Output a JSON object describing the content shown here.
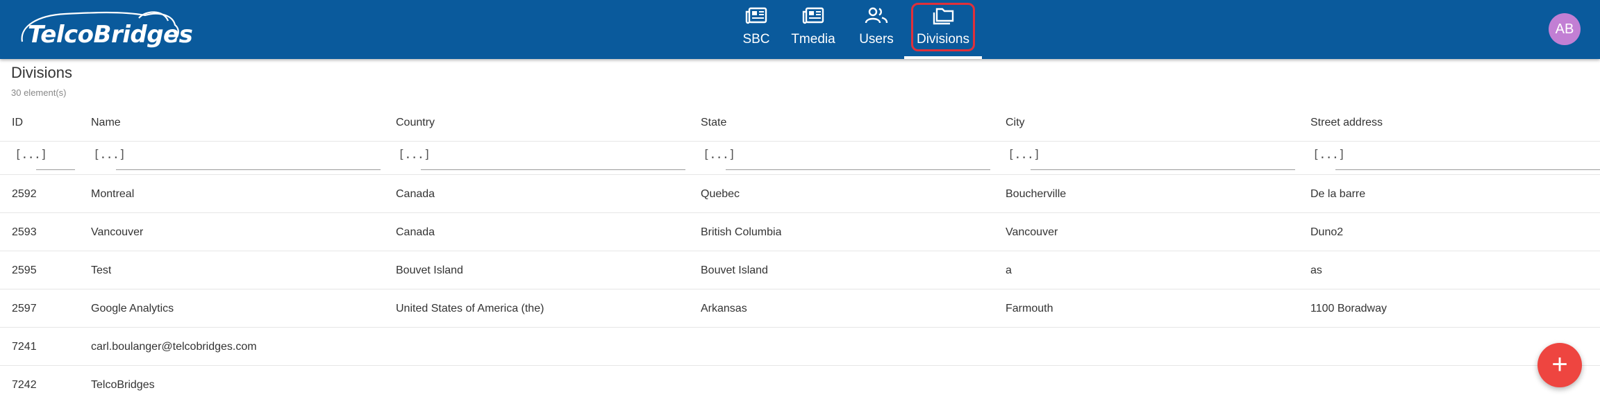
{
  "brand": {
    "logo_text": "TelcoBridges"
  },
  "nav": [
    {
      "label": "SBC",
      "icon": "newspaper-icon"
    },
    {
      "label": "Tmedia",
      "icon": "newspaper-icon"
    },
    {
      "label": "Users",
      "icon": "users-icon"
    },
    {
      "label": "Divisions",
      "icon": "folders-icon",
      "active": true
    }
  ],
  "user": {
    "initials": "AB"
  },
  "page": {
    "title": "Divisions",
    "count": "30 element(s)"
  },
  "table": {
    "columns": [
      "ID",
      "Name",
      "Country",
      "State",
      "City",
      "Street address"
    ],
    "filter_button": "[...]",
    "rows": [
      {
        "id": "2592",
        "name": "Montreal",
        "country": "Canada",
        "state": "Quebec",
        "city": "Boucherville",
        "street": "De la barre"
      },
      {
        "id": "2593",
        "name": "Vancouver",
        "country": "Canada",
        "state": "British Columbia",
        "city": "Vancouver",
        "street": "Duno2"
      },
      {
        "id": "2595",
        "name": "Test",
        "country": "Bouvet Island",
        "state": "Bouvet Island",
        "city": "a",
        "street": "as"
      },
      {
        "id": "2597",
        "name": "Google Analytics",
        "country": "United States of America (the)",
        "state": "Arkansas",
        "city": "Farmouth",
        "street": "1100 Boradway"
      },
      {
        "id": "7241",
        "name": "carl.boulanger@telcobridges.com",
        "country": "",
        "state": "",
        "city": "",
        "street": ""
      },
      {
        "id": "7242",
        "name": "TelcoBridges",
        "country": "",
        "state": "",
        "city": "",
        "street": ""
      }
    ]
  },
  "fab": {
    "label": "+"
  },
  "colors": {
    "header": "#0a5a9c",
    "active_highlight": "#e0303a",
    "fab": "#ee4540",
    "avatar": "#c27fd4"
  }
}
